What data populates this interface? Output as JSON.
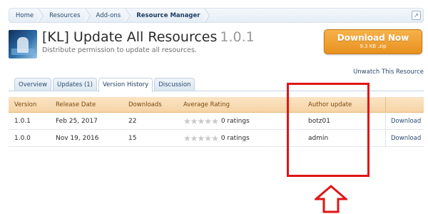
{
  "breadcrumb": [
    "Home",
    "Resources",
    "Add-ons",
    "Resource Manager"
  ],
  "header": {
    "title": "[KL] Update All Resources",
    "version": "1.0.1",
    "tagline": "Distribute permission to update all resources."
  },
  "download_button": {
    "label": "Download Now",
    "size": "9.3 KB .zip"
  },
  "unwatch_label": "Unwatch This Resource",
  "tabs": [
    "Overview",
    "Updates (1)",
    "Version History",
    "Discussion"
  ],
  "active_tab": "Version History",
  "table": {
    "headers": [
      "Version",
      "Release Date",
      "Downloads",
      "Average Rating",
      "Author update"
    ],
    "rows": [
      {
        "version": "1.0.1",
        "date": "Feb 25, 2017",
        "downloads": "22",
        "rating": "0 ratings",
        "author": "botz01",
        "action": "Download"
      },
      {
        "version": "1.0.0",
        "date": "Nov 19, 2016",
        "downloads": "15",
        "rating": "0 ratings",
        "author": "admin",
        "action": "Download"
      }
    ]
  },
  "colors": {
    "annotation": "#e01515",
    "button": "#f0a030",
    "link": "#2b4a6f"
  },
  "icons": [
    "expand-icon",
    "star-icon",
    "up-arrow-icon"
  ]
}
